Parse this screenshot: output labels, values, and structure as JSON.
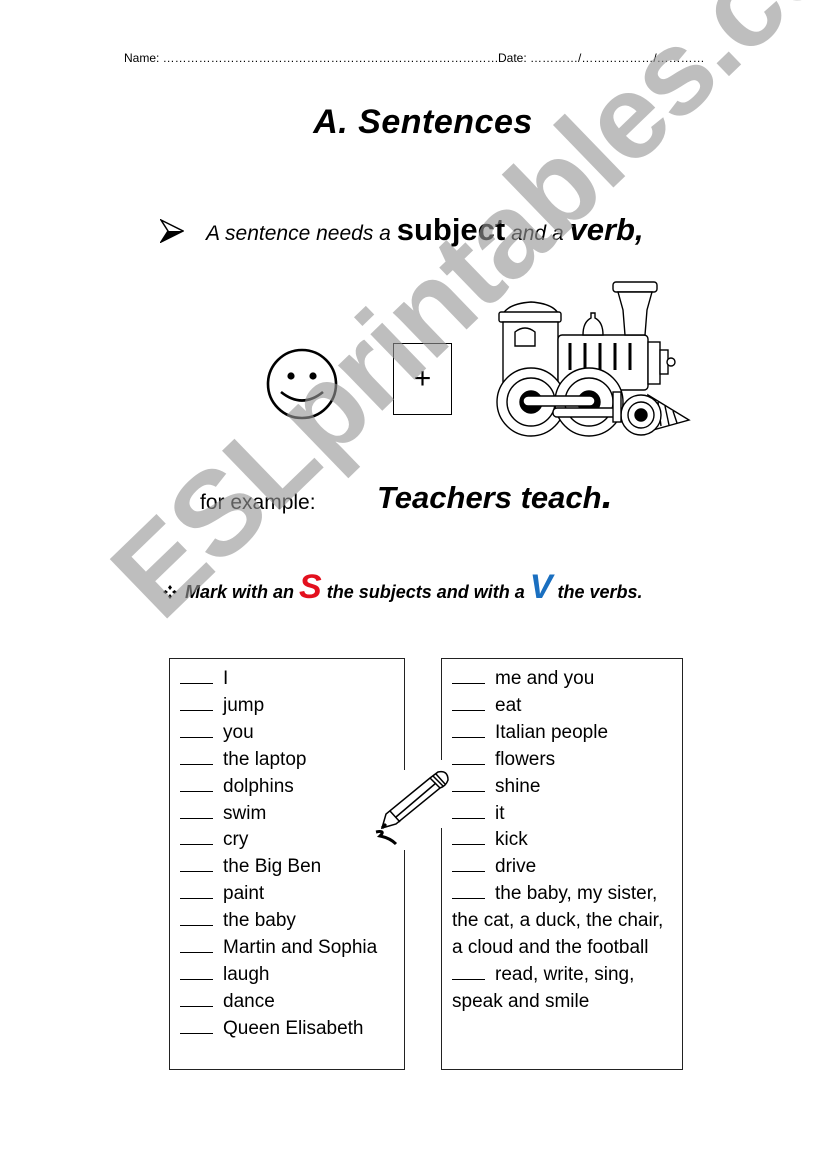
{
  "header": {
    "name_label": "Name: …………………………………………………………………………",
    "date_label": "Date: …………/………………/…………"
  },
  "title": "A.  Sentences",
  "rule": {
    "icon": "arrowhead-bullet-icon",
    "prefix": "A sentence needs a ",
    "subject": "subject",
    "middle": " and a ",
    "verb": "verb,"
  },
  "illustration": {
    "smiley_icon": "smiley-face-icon",
    "plus_symbol": "+",
    "train_icon": "steam-locomotive-icon"
  },
  "example": {
    "label": "for example:",
    "sentence": "Teachers  teach",
    "period": "."
  },
  "instruction": {
    "icon": "diamond-bullet-icon",
    "part1": "Mark with an ",
    "s_letter": "S",
    "part2": " the subjects and with a ",
    "v_letter": "V",
    "part3": " the verbs.",
    "s_color": "#e3101e",
    "v_color": "#1a6fc0"
  },
  "list_left": [
    "I",
    "jump",
    "you",
    "the laptop",
    "dolphins",
    "swim",
    "cry",
    "the Big Ben",
    "paint",
    "the baby",
    "Martin and Sophia",
    "laugh",
    "dance",
    "Queen Elisabeth"
  ],
  "list_right": [
    "me and you",
    "eat",
    "Italian people",
    "flowers",
    "shine",
    "it",
    "kick",
    "drive",
    "the baby, my sister, the cat, a duck, the chair, a cloud and the football",
    "read, write, sing, speak and smile"
  ],
  "pencil_icon": "pencil-icon",
  "watermark": "ESLprintables.com"
}
